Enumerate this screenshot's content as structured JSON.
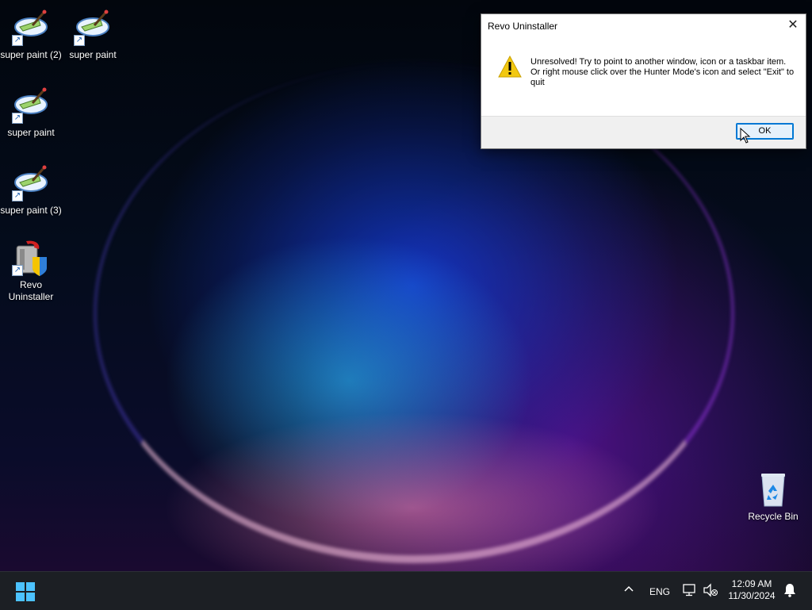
{
  "desktop": {
    "icons": [
      {
        "label": "super paint (2)"
      },
      {
        "label": "super paint"
      },
      {
        "label": "super paint"
      },
      {
        "label": "super paint (3)"
      },
      {
        "label": "Revo Uninstaller"
      },
      {
        "label": "Recycle Bin"
      }
    ]
  },
  "dialog": {
    "title": "Revo Uninstaller",
    "message_line1": "Unresolved! Try to point to another window, icon or a taskbar item.",
    "message_line2": "Or right mouse click over the Hunter Mode's icon and select \"Exit\" to quit",
    "ok_label": "OK",
    "icon": "warning-icon"
  },
  "taskbar": {
    "language": "ENG",
    "time": "12:09 AM",
    "date": "11/30/2024"
  },
  "colors": {
    "accent": "#0078d4",
    "taskbar_bg": "#1c1f24",
    "warning_yellow": "#f2c811"
  }
}
